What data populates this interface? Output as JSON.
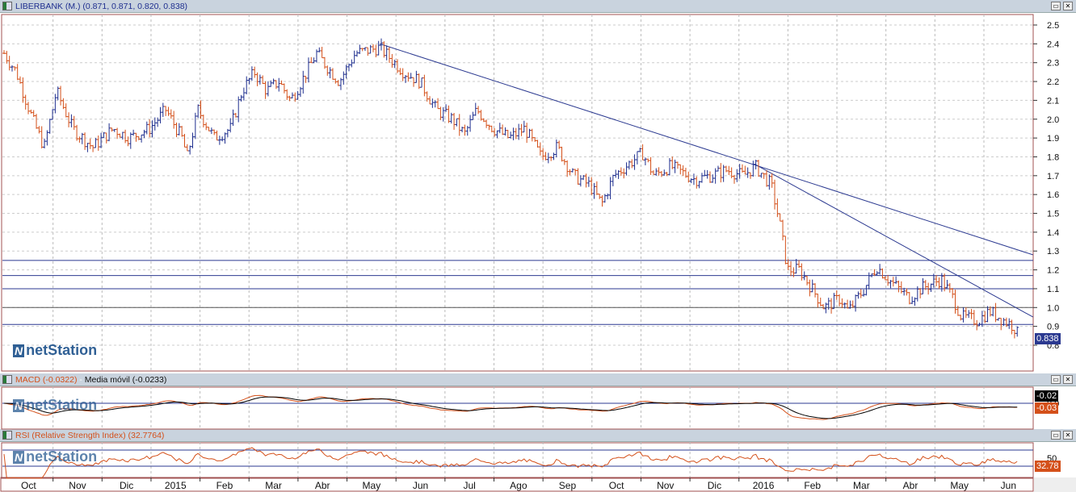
{
  "title": "LIBERBANK (M.) (0.871, 0.871, 0.820, 0.838)",
  "macd_title": "MACD (-0.0322)",
  "macd_ma_title": "Media móvil (-0.0233)",
  "rsi_title": "RSI (Relative Strength Index) (32.7764)",
  "logo": "netStation",
  "last_price": "0.838",
  "macd_value": "-0.02",
  "macd_signal_value": "-0.03",
  "rsi_value": "32.78",
  "colors": {
    "up": "#1f2f8f",
    "down": "#d4501a",
    "line": "#2b3990",
    "tag_price": "#2b3990",
    "tag_rsi": "#d4501a"
  },
  "chart_data": {
    "type": "ohlc",
    "price_ticks": [
      "2.5",
      "2.4",
      "2.3",
      "2.2",
      "2.1",
      "2.0",
      "1.9",
      "1.8",
      "1.7",
      "1.6",
      "1.5",
      "1.4",
      "1.3",
      "1.2",
      "1.1",
      "1.0",
      "0.9",
      "0.8"
    ],
    "ylim": [
      0.8,
      2.5
    ],
    "x_unit": "months since Oct 2014",
    "months": [
      "Oct",
      "Nov",
      "Dic",
      "2015",
      "Feb",
      "Mar",
      "Abr",
      "May",
      "Jun",
      "Jul",
      "Ago",
      "Sep",
      "Oct",
      "Nov",
      "Dic",
      "2016",
      "Feb",
      "Mar",
      "Abr",
      "May",
      "Jun"
    ],
    "close_path": [
      [
        0,
        2.35
      ],
      [
        0.25,
        2.25
      ],
      [
        0.58,
        2.0
      ],
      [
        0.82,
        1.85
      ],
      [
        1.07,
        2.15
      ],
      [
        1.4,
        1.95
      ],
      [
        1.81,
        1.85
      ],
      [
        2.23,
        1.95
      ],
      [
        2.56,
        1.9
      ],
      [
        2.97,
        1.95
      ],
      [
        3.3,
        2.05
      ],
      [
        3.63,
        1.9
      ],
      [
        3.74,
        1.8
      ],
      [
        3.96,
        2.05
      ],
      [
        4.29,
        1.9
      ],
      [
        4.62,
        1.95
      ],
      [
        4.86,
        2.15
      ],
      [
        5.11,
        2.25
      ],
      [
        5.36,
        2.15
      ],
      [
        5.61,
        2.2
      ],
      [
        5.85,
        2.1
      ],
      [
        6.18,
        2.25
      ],
      [
        6.38,
        2.35
      ],
      [
        6.68,
        2.25
      ],
      [
        6.84,
        2.2
      ],
      [
        7.17,
        2.35
      ],
      [
        7.67,
        2.38
      ],
      [
        8.16,
        2.25
      ],
      [
        8.49,
        2.2
      ],
      [
        8.82,
        2.05
      ],
      [
        9.15,
        2.0
      ],
      [
        9.4,
        1.92
      ],
      [
        9.65,
        2.05
      ],
      [
        9.98,
        1.95
      ],
      [
        10.31,
        1.9
      ],
      [
        10.63,
        1.95
      ],
      [
        10.96,
        1.8
      ],
      [
        11.29,
        1.85
      ],
      [
        11.62,
        1.7
      ],
      [
        11.95,
        1.65
      ],
      [
        12.2,
        1.55
      ],
      [
        12.45,
        1.7
      ],
      [
        13.03,
        1.82
      ],
      [
        13.27,
        1.7
      ],
      [
        13.6,
        1.75
      ],
      [
        14.1,
        1.68
      ],
      [
        14.43,
        1.7
      ],
      [
        14.76,
        1.73
      ],
      [
        15.09,
        1.7
      ],
      [
        15.33,
        1.75
      ],
      [
        15.66,
        1.65
      ],
      [
        15.83,
        1.45
      ],
      [
        15.99,
        1.2
      ],
      [
        16.24,
        1.2
      ],
      [
        16.49,
        1.1
      ],
      [
        16.74,
        1.0
      ],
      [
        17.07,
        1.05
      ],
      [
        17.23,
        0.98
      ],
      [
        17.56,
        1.1
      ],
      [
        17.81,
        1.22
      ],
      [
        18.05,
        1.15
      ],
      [
        18.47,
        1.05
      ],
      [
        18.71,
        1.1
      ],
      [
        19.13,
        1.15
      ],
      [
        19.37,
        1.05
      ],
      [
        19.54,
        0.95
      ],
      [
        19.87,
        0.93
      ],
      [
        20.12,
        0.98
      ],
      [
        20.36,
        0.94
      ],
      [
        20.61,
        0.9
      ],
      [
        20.72,
        0.84
      ]
    ],
    "horizontal_levels": [
      1.25,
      1.17,
      1.1,
      1.0,
      0.91
    ],
    "trendlines": [
      [
        [
          7.67,
          2.4
        ],
        [
          21.0,
          1.28
        ]
      ],
      [
        [
          15.33,
          1.76
        ],
        [
          21.0,
          0.95
        ]
      ]
    ],
    "macd_ticks": [
      "0.0"
    ],
    "rsi_ticks": [
      "50"
    ],
    "rsi_levels": [
      70,
      30
    ]
  }
}
